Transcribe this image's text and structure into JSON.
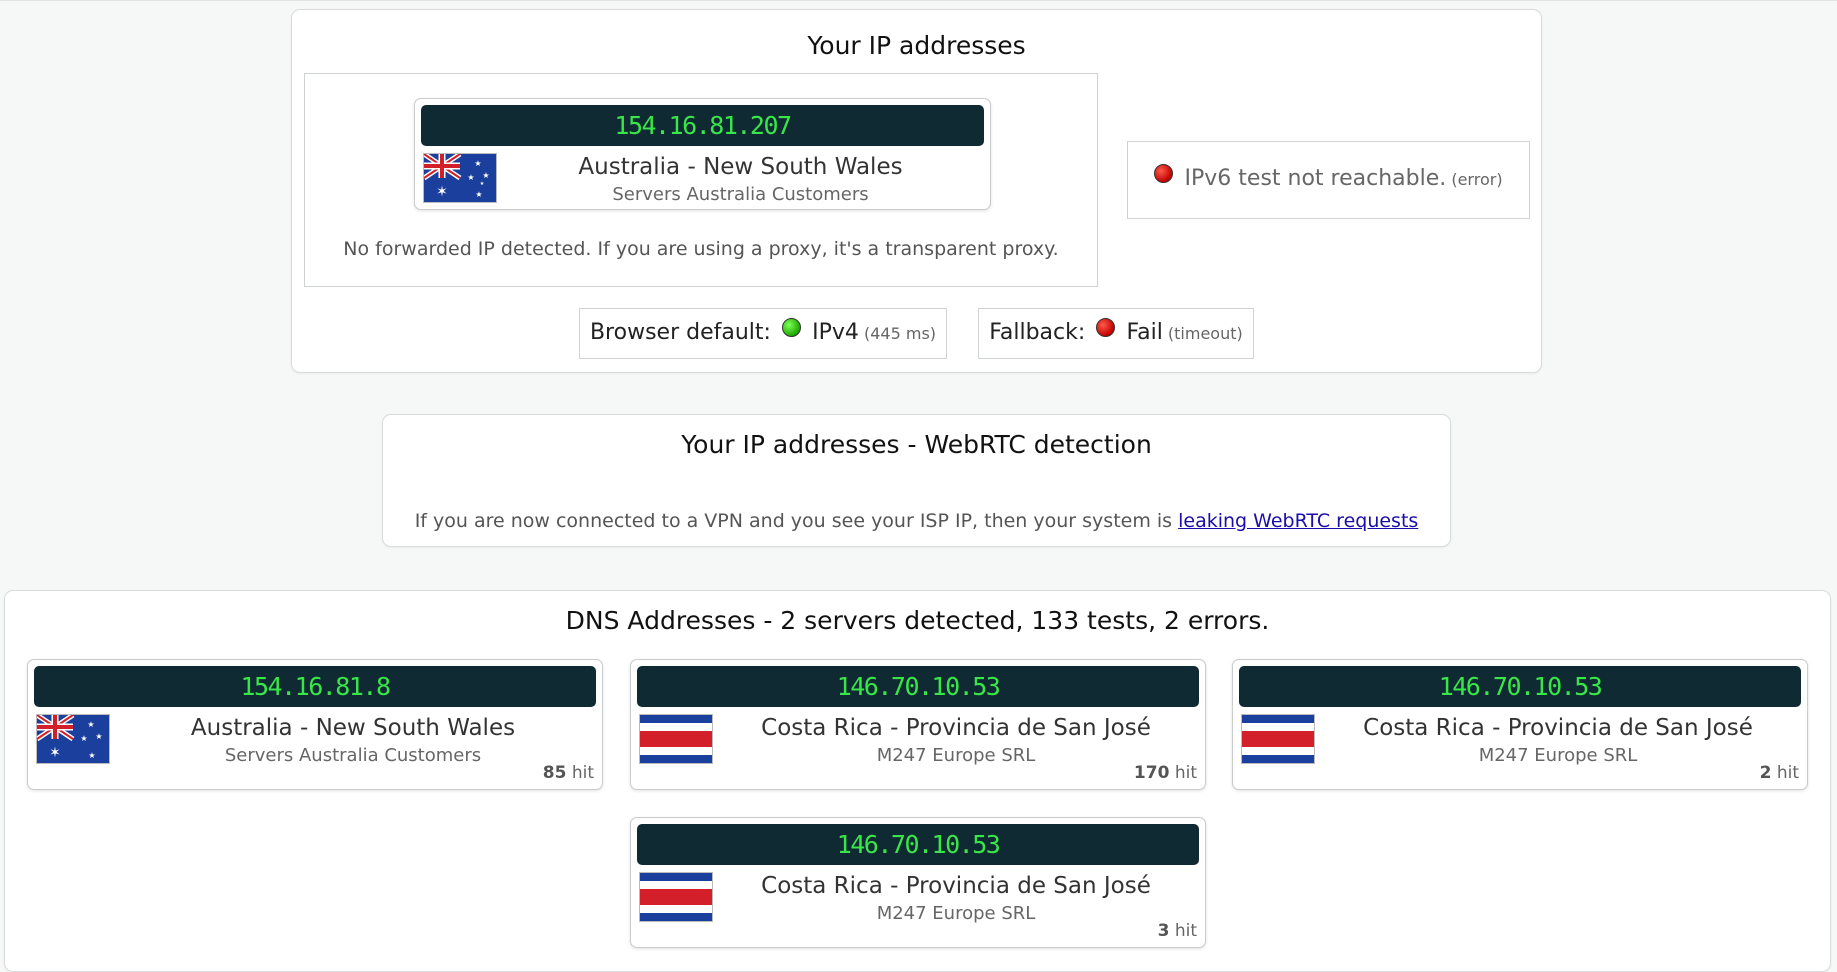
{
  "ip_panel": {
    "title": "Your IP addresses",
    "ipv4": {
      "ip": "154.16.81.207",
      "location": "Australia - New South Wales",
      "isp": "Servers Australia Customers",
      "flag": "australia-flag"
    },
    "forwarded_note": "No forwarded IP detected. If you are using a proxy, it's a transparent proxy.",
    "ipv6": {
      "message": "IPv6 test not reachable.",
      "status": "(error)"
    },
    "browser_default": {
      "label": "Browser default:",
      "value": "IPv4",
      "detail": "(445 ms)"
    },
    "fallback": {
      "label": "Fallback:",
      "value": "Fail",
      "detail": "(timeout)"
    }
  },
  "webrtc_panel": {
    "title": "Your IP addresses - WebRTC detection",
    "note": "If you are now connected to a VPN and you see your ISP IP, then your system is",
    "link": "leaking WebRTC requests"
  },
  "dns_panel": {
    "title": "DNS Addresses - 2 servers detected, 133 tests, 2 errors.",
    "hit_suffix": "hit",
    "servers": [
      {
        "ip": "154.16.81.8",
        "location": "Australia - New South Wales",
        "isp": "Servers Australia Customers",
        "hits": "85",
        "flag": "australia-flag"
      },
      {
        "ip": "146.70.10.53",
        "location": "Costa Rica - Provincia de San José",
        "isp": "M247 Europe SRL",
        "hits": "170",
        "flag": "costa-rica-flag"
      },
      {
        "ip": "146.70.10.53",
        "location": "Costa Rica - Provincia de San José",
        "isp": "M247 Europe SRL",
        "hits": "2",
        "flag": "costa-rica-flag"
      },
      {
        "ip": "146.70.10.53",
        "location": "Costa Rica - Provincia de San José",
        "isp": "M247 Europe SRL",
        "hits": "3",
        "flag": "costa-rica-flag"
      }
    ]
  },
  "colors": {
    "ip_bar_bg": "#0f2a33",
    "ip_text": "#39e648",
    "status_error": "#c10000",
    "status_ok": "#1fa800",
    "link": "#1a0dab"
  }
}
